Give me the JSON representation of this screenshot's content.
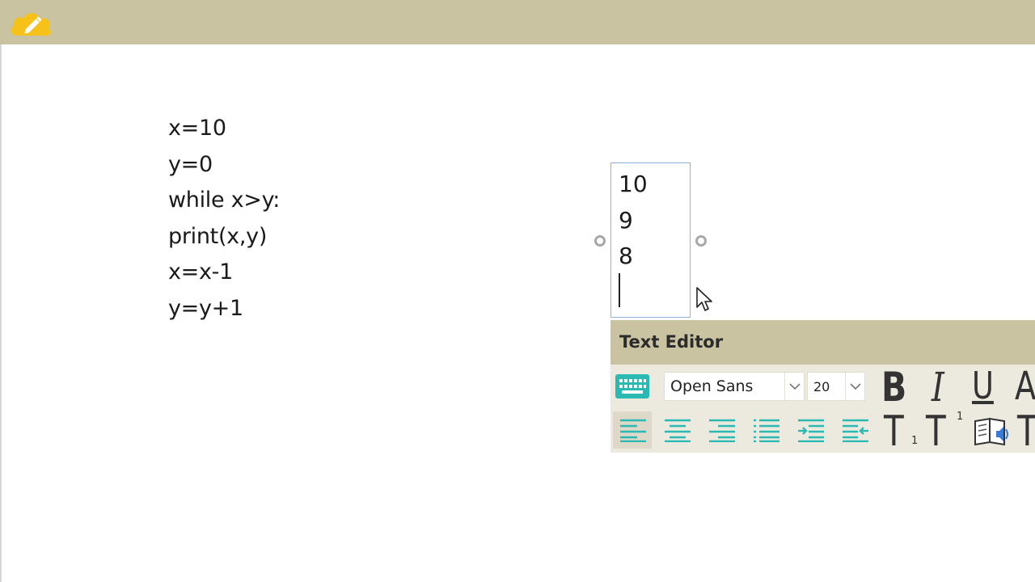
{
  "topbar": {
    "icon": "pencil-icon",
    "accent": "#f6c21a",
    "background": "#cac3a1"
  },
  "code": {
    "lines": [
      "x=10",
      "y=0",
      "while x>y:",
      "print(x,y)",
      "x=x-1",
      "y=y+1"
    ]
  },
  "textbox": {
    "lines": [
      "10",
      "9",
      "8"
    ]
  },
  "editor": {
    "title": "Text Editor",
    "font": "Open Sans",
    "size": "20",
    "bold": "B",
    "italic": "I",
    "underline": "U",
    "strike": "A",
    "subscript": "T",
    "subscript_mark": "1",
    "superscript": "T",
    "superscript_mark": "1",
    "last": "T",
    "accent": "#2bbab3",
    "icons": [
      "keyboard-icon",
      "align-left-icon",
      "align-center-icon",
      "align-right-icon",
      "list-icon",
      "indent-icon",
      "outdent-icon",
      "immersive-reader-icon"
    ]
  }
}
